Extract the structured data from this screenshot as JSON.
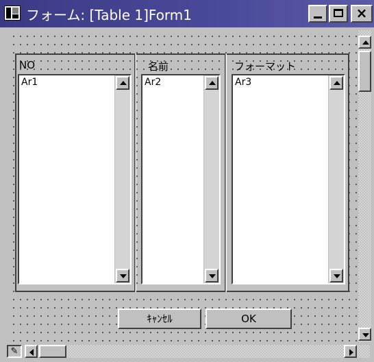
{
  "window": {
    "title": "フォーム: [Table 1]Form1",
    "controls": {
      "close_label": "×"
    }
  },
  "form": {
    "columns": [
      {
        "label": "NO",
        "list_item": "Ar1"
      },
      {
        "label": "名前",
        "list_item": "Ar2"
      },
      {
        "label": "フォーマット",
        "list_item": "Ar3"
      }
    ],
    "buttons": {
      "cancel_label": "ｷｬﾝｾﾙ",
      "ok_label": "OK"
    }
  },
  "colors": {
    "titlebar": "#3a3a84",
    "face": "#c0c0c0"
  },
  "icons": [
    "form-icon",
    "minimize-icon",
    "maximize-icon",
    "close-icon",
    "scroll-up-icon",
    "scroll-down-icon",
    "scroll-left-icon",
    "scroll-right-icon",
    "pencil-icon"
  ]
}
